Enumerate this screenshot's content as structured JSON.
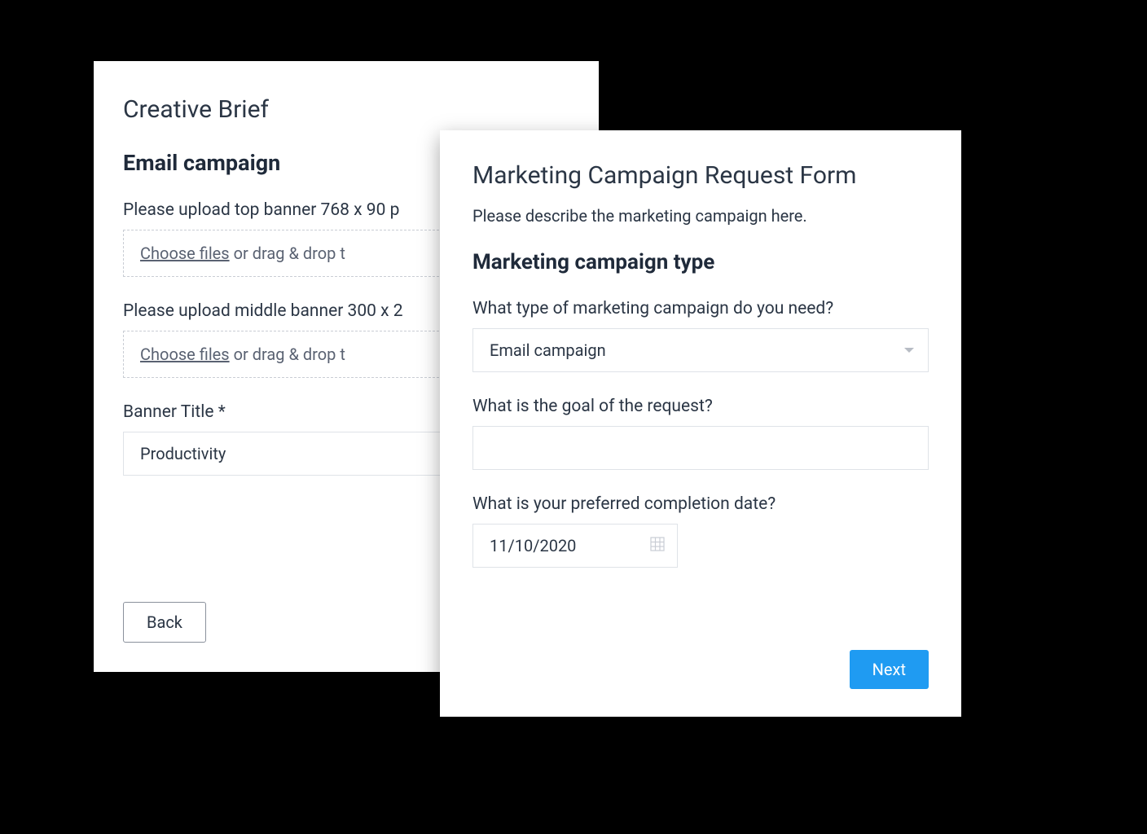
{
  "back_card": {
    "title": "Creative Brief",
    "section_title": "Email campaign",
    "upload_top_label": "Please upload top banner 768 x 90 p",
    "upload_middle_label": "Please upload middle banner 300 x 2",
    "choose_files_text": "Choose files",
    "drag_drop_text": " or drag & drop t",
    "banner_title_label": "Banner Title *",
    "banner_title_value": "Productivity",
    "back_button": "Back"
  },
  "front_card": {
    "title": "Marketing Campaign Request Form",
    "description": "Please describe the marketing campaign here.",
    "section_title": "Marketing campaign type",
    "type_label": "What type of marketing campaign do you need?",
    "type_value": "Email campaign",
    "goal_label": "What is the goal of the request?",
    "goal_value": "",
    "date_label": "What is your preferred completion date?",
    "date_value": "11/10/2020",
    "next_button": "Next"
  }
}
